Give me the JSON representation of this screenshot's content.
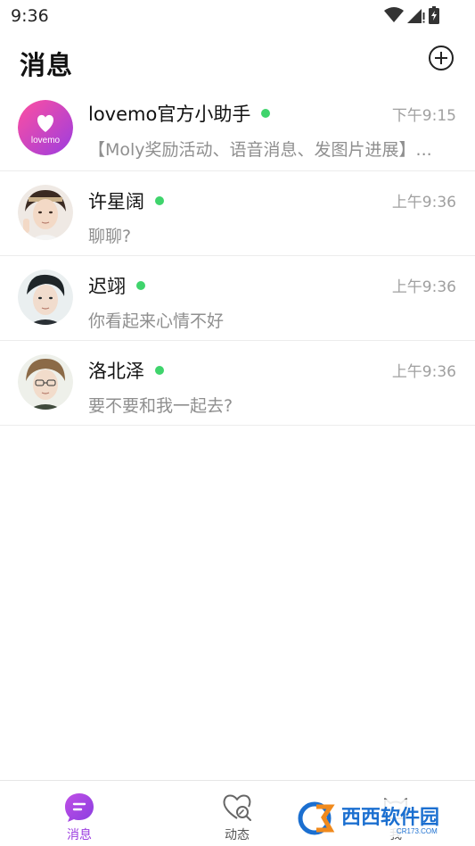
{
  "status_bar": {
    "time": "9:36"
  },
  "header": {
    "title": "消息"
  },
  "messages": [
    {
      "name": "lovemo官方小助手",
      "time": "下午9:15",
      "preview": "【Moly奖励活动、语音消息、发图片进展】...",
      "online": true,
      "avatar_text": "lovemo"
    },
    {
      "name": "许星阔",
      "time": "上午9:36",
      "preview": "聊聊?",
      "online": true
    },
    {
      "name": "迟翊",
      "time": "上午9:36",
      "preview": "你看起来心情不好",
      "online": true
    },
    {
      "name": "洛北泽",
      "time": "上午9:36",
      "preview": "要不要和我一起去?",
      "online": true
    }
  ],
  "nav": [
    {
      "label": "消息",
      "icon": "chat-bubble-icon",
      "active": true
    },
    {
      "label": "动态",
      "icon": "heart-search-icon",
      "active": false
    },
    {
      "label": "我",
      "icon": "cat-face-icon",
      "active": false
    }
  ],
  "watermark": {
    "text": "西西软件园",
    "subtext": "CR173.COM"
  },
  "colors": {
    "accent": "#9b3de0",
    "online": "#3fd46c",
    "muted": "#8f8f8f"
  }
}
